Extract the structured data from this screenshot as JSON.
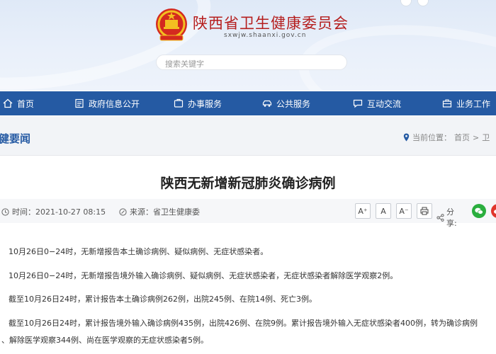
{
  "site": {
    "title": "陕西省卫生健康委员会",
    "domain": "sxwjw.shaanxi.gov.cn",
    "search_placeholder": "搜索关键字"
  },
  "nav": {
    "items": [
      {
        "label": "首页",
        "icon": "home-icon"
      },
      {
        "label": "政府信息公开",
        "icon": "document-icon"
      },
      {
        "label": "办事服务",
        "icon": "service-icon"
      },
      {
        "label": "公共服务",
        "icon": "car-icon"
      },
      {
        "label": "互动交流",
        "icon": "chat-icon"
      },
      {
        "label": "业务工作",
        "icon": "briefcase-icon"
      }
    ]
  },
  "breadcrumb": {
    "section": "健要闻",
    "location_label": "当前位置：",
    "home": "首页",
    "separator": ">",
    "current": "卫"
  },
  "article": {
    "title": "陕西无新增新冠肺炎确诊病例",
    "time_label": "时间：2021-10-27 08:15",
    "source_label": "来源：省卫生健康委",
    "font_buttons": [
      "A⁺",
      "A",
      "A⁻"
    ],
    "share_label": "分享:",
    "paragraphs": [
      "10月26日0−24时，无新增报告本土确诊病例、疑似病例、无症状感染者。",
      "10月26日0−24时，无新增报告境外输入确诊病例、疑似病例、无症状感染者，无症状感染者解除医学观察2例。",
      "截至10月26日24时，累计报告本土确诊病例262例，出院245例、在院14例、死亡3例。",
      "截至10月26日24时，累计报告境外输入确诊病例435例，出院426例、在院9例。累计报告境外输入无症状感染者400例，转为确诊病例",
      "、解除医学观察344例、尚在医学观察的无症状感染者5例。"
    ]
  },
  "colors": {
    "nav_bg": "#255aa3",
    "title_red": "#b51e1e",
    "wechat": "#2aae3e",
    "weibo": "#e0352c"
  }
}
